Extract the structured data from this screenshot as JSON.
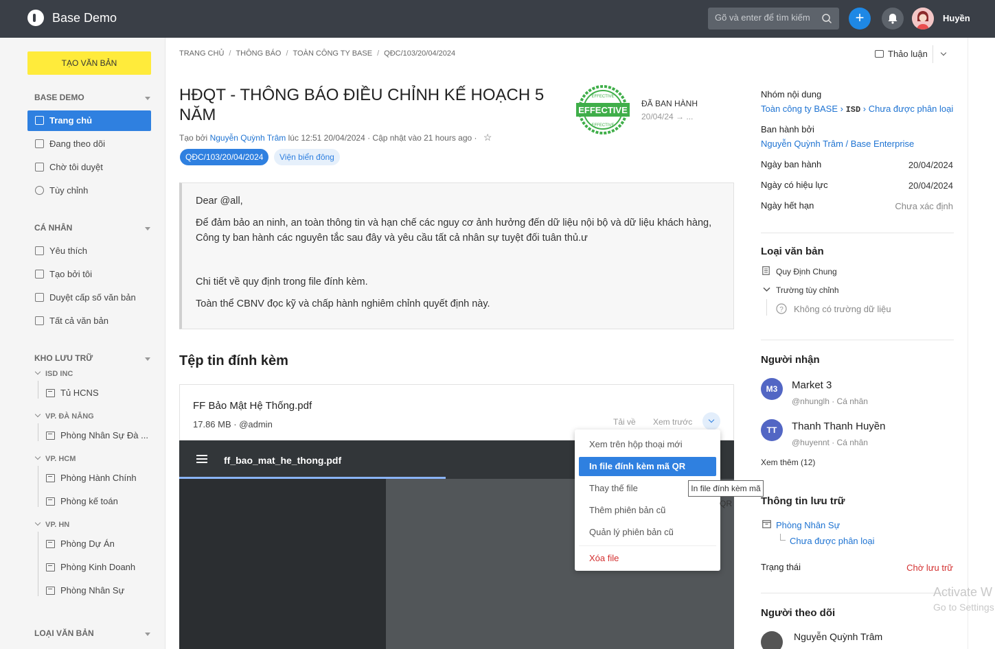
{
  "header": {
    "app_title": "Base Demo",
    "search_placeholder": "Gõ và enter để tìm kiếm",
    "user_name": "Huyền",
    "plus_label": "+"
  },
  "sidebar": {
    "create_button": "TẠO VĂN BẢN",
    "sections": {
      "base_demo": "BASE DEMO",
      "ca_nhan": "CÁ NHÂN",
      "kho_luu_tru": "KHO LƯU TRỮ",
      "loai_van_ban": "LOẠI VĂN BẢN"
    },
    "main_items": [
      "Trang chủ",
      "Đang theo dõi",
      "Chờ tôi duyệt",
      "Tùy chỉnh"
    ],
    "personal_items": [
      "Yêu thích",
      "Tạo bởi tôi",
      "Duyệt cấp số văn bản",
      "Tất cả văn bản"
    ],
    "storage_groups": [
      {
        "name": "ISD INC",
        "items": [
          "Tủ HCNS"
        ]
      },
      {
        "name": "VP. ĐÀ NẴNG",
        "items": [
          "Phòng Nhân Sự Đà ..."
        ]
      },
      {
        "name": "VP. HCM",
        "items": [
          "Phòng Hành Chính",
          "Phòng kế toán"
        ]
      },
      {
        "name": "VP. HN",
        "items": [
          "Phòng Dự Án",
          "Phòng Kinh Doanh",
          "Phòng Nhân Sự"
        ]
      }
    ]
  },
  "breadcrumb": [
    "TRANG CHỦ",
    "THÔNG BÁO",
    "TOÀN CÔNG TY BASE",
    "QĐC/103/20/04/2024"
  ],
  "discussion_label": "Thảo luận",
  "document": {
    "title": "HĐQT - THÔNG BÁO ĐIỀU CHỈNH KẾ HOẠCH 5 NĂM",
    "stamp_text": "EFFECTIVE",
    "stamp_ring": "EFFECTIVE",
    "status": "ĐÃ BAN HÀNH",
    "status_date": "20/04/24 → ...",
    "meta_prefix": "Tạo bởi",
    "meta_author": "Nguyễn Quỳnh Trâm",
    "meta_suffix": "lúc 12:51 20/04/2024 · Cập nhật vào 21 hours ago ·",
    "tags": [
      "QĐC/103/20/04/2024",
      "Viện biển đông"
    ],
    "body": [
      "Dear @all,",
      "Để đảm bảo an ninh, an toàn thông tin và hạn chế các nguy cơ ảnh hưởng đến dữ liệu nội bộ và dữ liệu khách hàng,",
      "Công ty ban hành các nguyên tắc sau đây và yêu cầu tất cả nhân sự tuyệt đối tuân thủ.ư",
      "Chi tiết về quy định trong file đính kèm.",
      "Toàn thể CBNV đọc kỹ và chấp hành nghiêm chỉnh quyết định này."
    ]
  },
  "attachments": {
    "title": "Tệp tin đính kèm",
    "file_name": "FF Bảo Mật Hệ Thống.pdf",
    "file_meta": "17.86 MB · @admin",
    "download": "Tải về",
    "preview": "Xem trước",
    "pdf_filename": "ff_bao_mat_he_thong.pdf"
  },
  "file_menu": {
    "items": [
      "Xem trên hộp thoại mới",
      "In file đính kèm mã QR",
      "Thay thế file",
      "Thêm phiên bản cũ",
      "Quản lý phiên bản cũ"
    ],
    "danger": "Xóa file",
    "tooltip": "In file đính kèm mã QR"
  },
  "right_panel": {
    "content_group_label": "Nhóm nội dung",
    "content_group_part1": "Toàn công ty BASE",
    "content_group_isd": "ISD",
    "content_group_part2": "Chưa được phân loại",
    "issued_by_label": "Ban hành bởi",
    "issued_by_value": "Nguyễn Quỳnh Trâm / Base Enterprise",
    "issue_date_label": "Ngày ban hành",
    "issue_date_value": "20/04/2024",
    "effective_date_label": "Ngày có hiệu lực",
    "effective_date_value": "20/04/2024",
    "expire_date_label": "Ngày hết hạn",
    "expire_date_value": "Chưa xác định",
    "doc_type_heading": "Loại văn bản",
    "doc_type_value": "Quy Định Chung",
    "custom_fields_label": "Trường tùy chỉnh",
    "no_fields": "Không có trường dữ liệu",
    "recipients_heading": "Người nhận",
    "recipients": [
      {
        "initials": "M3",
        "name": "Market 3",
        "sub": "@nhunglh · Cá nhân"
      },
      {
        "initials": "TT",
        "name": "Thanh Thanh Huyền",
        "sub": "@huyennt · Cá nhân"
      }
    ],
    "see_more": "Xem thêm (12)",
    "storage_heading": "Thông tin lưu trữ",
    "storage_folder": "Phòng Nhân Sự",
    "storage_sub": "Chưa được phân loại",
    "status_label": "Trạng thái",
    "status_value": "Chờ lưu trữ",
    "followers_heading": "Người theo dõi",
    "follower_name": "Nguyễn Quỳnh Trâm"
  },
  "watermark": {
    "line1": "Activate W",
    "line2": "Go to Settings"
  },
  "colors": {
    "topbar": "#3a3f47",
    "accent": "#2f80e0",
    "create_button": "#ffeb3b",
    "danger": "#d32f2f",
    "stamp": "#3fae49"
  }
}
